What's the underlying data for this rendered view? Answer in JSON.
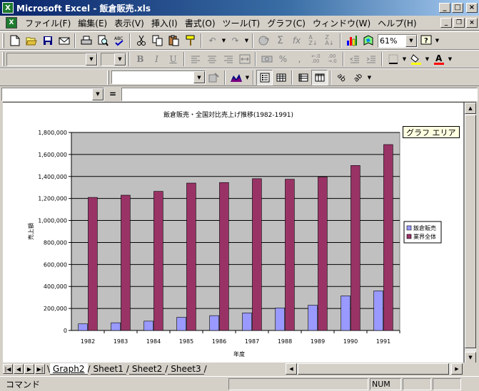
{
  "window": {
    "title": "Microsoft Excel - 飯倉販売.xls",
    "app_icon": "excel-icon",
    "controls": [
      "_",
      "□",
      "×"
    ]
  },
  "menubar": {
    "items": [
      "ファイル(F)",
      "編集(E)",
      "表示(V)",
      "挿入(I)",
      "書式(O)",
      "ツール(T)",
      "グラフ(C)",
      "ウィンドウ(W)",
      "ヘルプ(H)"
    ],
    "mdi_controls": [
      "_",
      "❐",
      "×"
    ]
  },
  "standard_toolbar": {
    "zoom": "61%",
    "icons": [
      "new-icon",
      "open-icon",
      "save-icon",
      "email-icon",
      "print-icon",
      "print-preview-icon",
      "spelling-icon",
      "cut-icon",
      "copy-icon",
      "paste-icon",
      "format-painter-icon",
      "undo-icon",
      "redo-icon",
      "hyperlink-icon",
      "autosum-icon",
      "function-icon",
      "sort-ascending-icon",
      "sort-descending-icon",
      "chart-wizard-icon",
      "map-icon",
      "help-icon"
    ]
  },
  "formatting_toolbar": {
    "font_name": "",
    "font_size": "",
    "bold": "B",
    "italic": "I",
    "underline": "U",
    "fill_color": "#ffff00",
    "font_color": "#ff0000"
  },
  "chart_toolbar": {
    "chart_object": ""
  },
  "formula_bar": {
    "name_box": "",
    "equals": "=",
    "formula": ""
  },
  "tooltip": {
    "text": "グラフ エリア"
  },
  "chart_data": {
    "type": "bar",
    "title": "飯倉販売・全国対比売上げ推移(1982-1991)",
    "xlabel": "年度",
    "ylabel": "売上額",
    "categories": [
      "1982",
      "1983",
      "1984",
      "1985",
      "1986",
      "1987",
      "1988",
      "1989",
      "1990",
      "1991"
    ],
    "series": [
      {
        "name": "飯倉販売",
        "color": "#9999ff",
        "values": [
          60000,
          70000,
          85000,
          120000,
          135000,
          160000,
          205000,
          230000,
          315000,
          360000
        ]
      },
      {
        "name": "業界全体",
        "color": "#993366",
        "values": [
          1210000,
          1230000,
          1265000,
          1340000,
          1345000,
          1380000,
          1375000,
          1395000,
          1500000,
          1690000
        ]
      }
    ],
    "ylim": [
      0,
      1800000
    ],
    "yticks": [
      "0",
      "200,000",
      "400,000",
      "600,000",
      "800,000",
      "1,000,000",
      "1,200,000",
      "1,400,000",
      "1,600,000",
      "1,800,000"
    ],
    "grid": true,
    "plot_background": "#c0c0c0",
    "legend_position": "right"
  },
  "sheet_tabs": {
    "tabs": [
      "Graph2",
      "Sheet1",
      "Sheet2",
      "Sheet3"
    ],
    "active": "Graph2"
  },
  "statusbar": {
    "text": "コマンド",
    "num": "NUM"
  }
}
